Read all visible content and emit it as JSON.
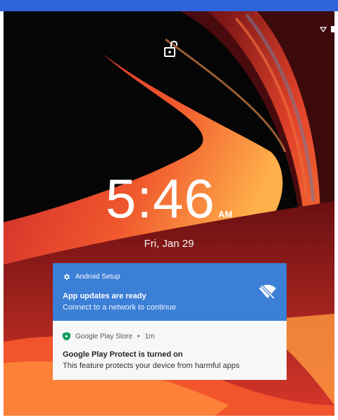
{
  "clock": {
    "time": "5:46",
    "ampm": "AM",
    "date": "Fri, Jan 29"
  },
  "notifications": [
    {
      "app_name": "Android Setup",
      "title": "App updates are ready",
      "text": "Connect to a network to continue",
      "icon": "gear-icon",
      "action_icon": "wifi-off-icon",
      "color": "#3b7fd6"
    },
    {
      "app_name": "Google Play Store",
      "time_ago": "1m",
      "title": "Google Play Protect is turned on",
      "text": "This feature protects your device from harmful apps",
      "icon": "play-protect-shield-icon",
      "color": "#f7f7f7"
    }
  ],
  "status_icons": [
    "wifi-icon",
    "battery-icon"
  ],
  "lock_icon": "unlocked-padlock-icon"
}
